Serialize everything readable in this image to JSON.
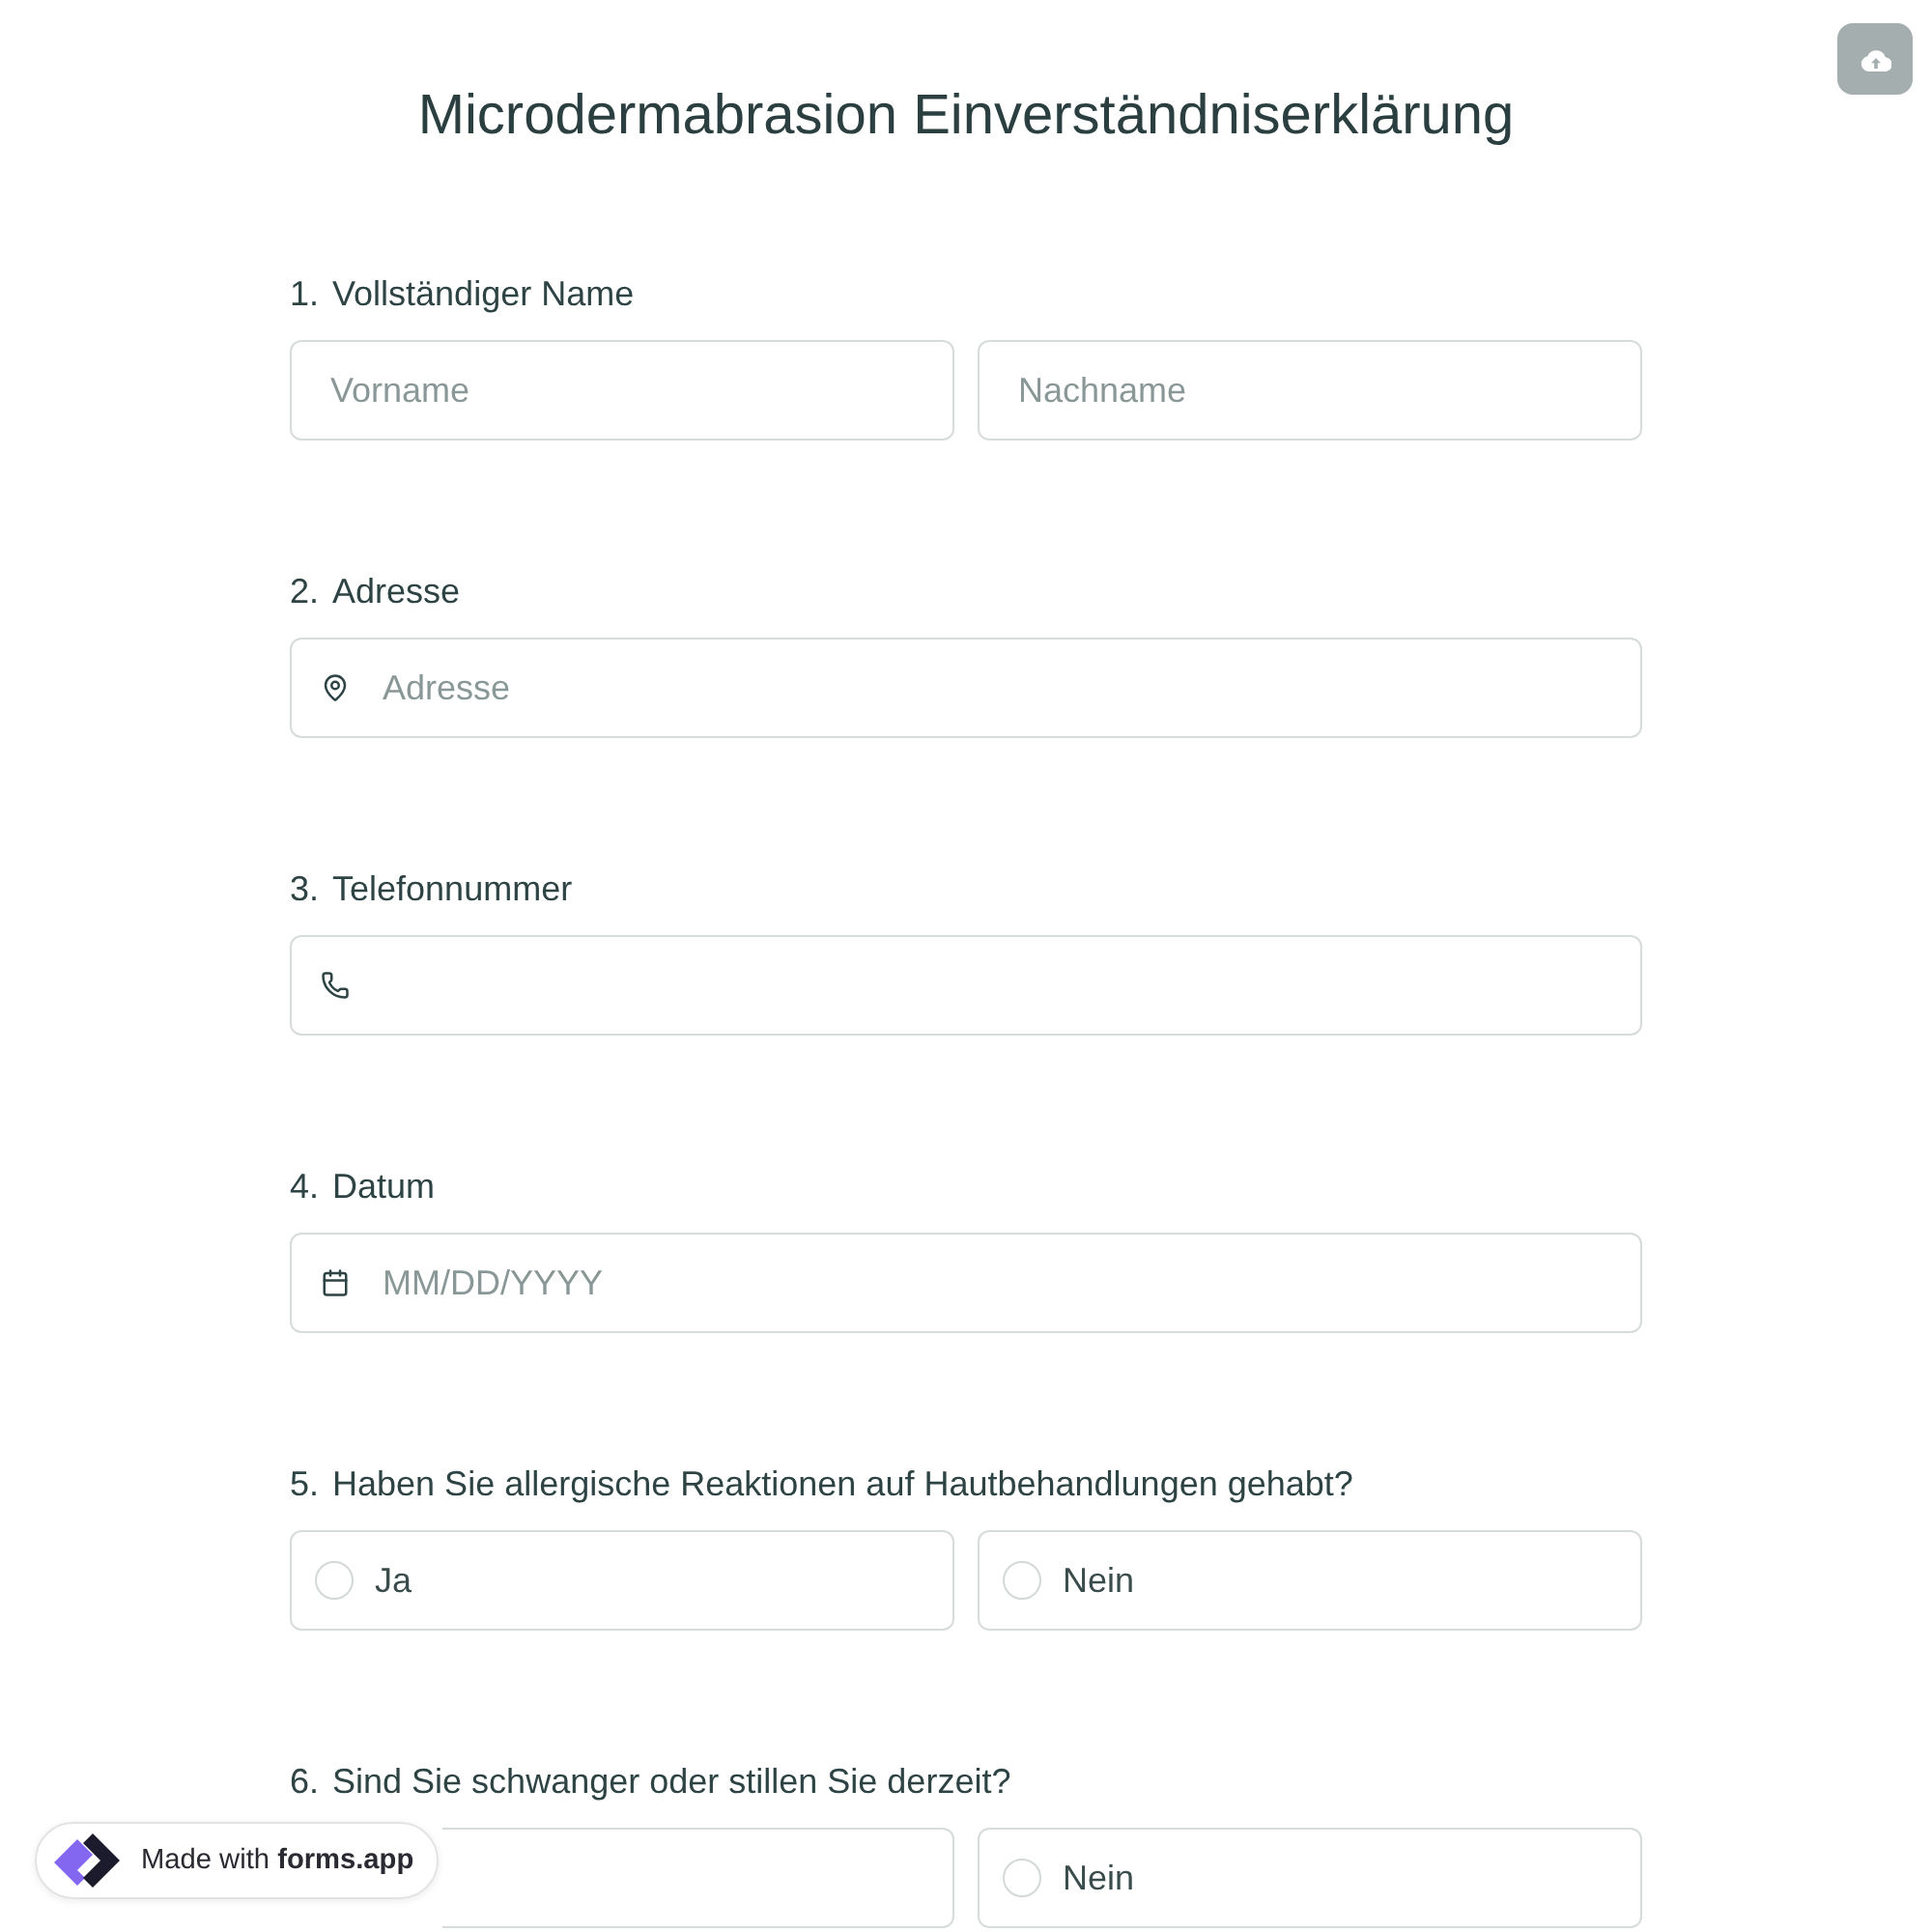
{
  "title": "Microdermabrasion Einverständniserklärung",
  "questions": [
    {
      "number": "1.",
      "label": "Vollständiger Name",
      "fields": [
        {
          "kind": "text",
          "placeholder": "Vorname"
        },
        {
          "kind": "text",
          "placeholder": "Nachname"
        }
      ]
    },
    {
      "number": "2.",
      "label": "Adresse",
      "fields": [
        {
          "kind": "address",
          "placeholder": "Adresse"
        }
      ]
    },
    {
      "number": "3.",
      "label": "Telefonnummer",
      "fields": [
        {
          "kind": "phone"
        }
      ]
    },
    {
      "number": "4.",
      "label": "Datum",
      "fields": [
        {
          "kind": "date",
          "placeholder": "MM/DD/YYYY"
        }
      ]
    },
    {
      "number": "5.",
      "label": "Haben Sie allergische Reaktionen auf Hautbehandlungen gehabt?",
      "options": [
        {
          "label": "Ja",
          "selected": false
        },
        {
          "label": "Nein",
          "selected": false
        }
      ]
    },
    {
      "number": "6.",
      "label": "Sind Sie schwanger oder stillen Sie derzeit?",
      "options": [
        {
          "selected": false
        },
        {
          "label": "Nein",
          "selected": false
        }
      ]
    }
  ],
  "badge": {
    "text": "Made with **forms.app**"
  }
}
